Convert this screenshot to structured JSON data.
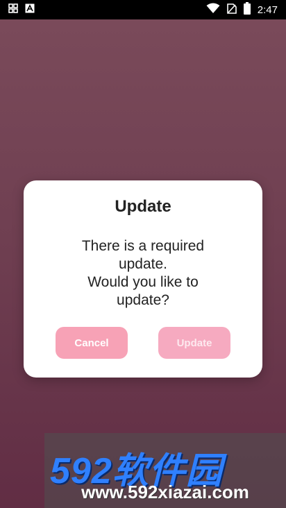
{
  "status_bar": {
    "time": "2:47",
    "left_icons": [
      "grid-app-icon",
      "text-a-icon"
    ],
    "right_icons": [
      "wifi-icon",
      "no-sim-icon",
      "battery-icon"
    ]
  },
  "dialog": {
    "title": "Update",
    "message_line1": "There is a required",
    "message_line2": "update.",
    "message_line3": "Would you like to",
    "message_line4": "update?",
    "cancel_label": "Cancel",
    "update_label": "Update"
  },
  "watermark": {
    "brand": "592软件园",
    "url": "www.592xiazai.com"
  },
  "colors": {
    "background_top": "#7a4a5a",
    "background_bottom": "#612d44",
    "button": "#f7a2b6",
    "dialog": "#ffffff"
  }
}
